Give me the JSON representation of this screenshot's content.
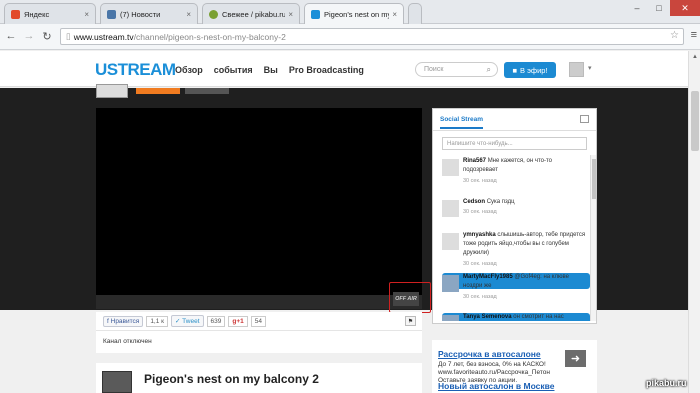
{
  "browser": {
    "tabs": [
      {
        "label": "Яндекс",
        "fav_color": "#e24b2b"
      },
      {
        "label": "(7) Новости",
        "fav_color": "#4a76a8"
      },
      {
        "label": "Свежее / pikabu.ru - Все",
        "fav_color": "#7aa032"
      },
      {
        "label": "Pigeon's nest on my balco",
        "fav_color": "#1b8fd8"
      }
    ],
    "url_host": "www.ustream.tv",
    "url_path": "/channel/pigeon-s-nest-on-my-balcony-2"
  },
  "header": {
    "logo": "USTREAM",
    "nav": [
      "Обзор",
      "события",
      "Вы",
      "Pro Broadcasting"
    ],
    "search_placeholder": "Поиск",
    "live_button": "В эфир!"
  },
  "player": {
    "status_badge": "OFF AIR"
  },
  "share": {
    "fb_label": "Нравится",
    "fb_count": "1,1 к",
    "tweet_label": "Tweet",
    "tweet_count": "639",
    "gplus_label": "+1",
    "gplus_count": "54"
  },
  "channel": {
    "status": "Канал отключен",
    "title": "Pigeon's nest on my balcony 2"
  },
  "social": {
    "tab": "Social Stream",
    "input_placeholder": "Напишите что-нибудь...",
    "posts": [
      {
        "user": "Rina567",
        "text": "Мне кажется, он что-то подозревает",
        "time": "30 сек. назад"
      },
      {
        "user": "Cedson",
        "text": "Сука пздц",
        "time": "30 сек. назад"
      },
      {
        "user": "ymnyashka",
        "text": "слышишь-автор, тебе придется тоже родить яйцо,чтобы вы с голубем дружили)",
        "time": "30 сек. назад"
      },
      {
        "user": "MartyMacFly1985",
        "text": "@Gof4eg: на клюве ноздри же",
        "time": "30 сек. назад"
      },
      {
        "user": "Tanya Semenova",
        "text": "он смотрит на нас",
        "time": ""
      }
    ]
  },
  "ad": {
    "headline1": "Рассрочка в автосалоне",
    "text": "До 7 лет, без взноса, 0% на КАСКО! www.favoriteauto.ru/Рассрочка_Петон Оставьте заявку по акции.",
    "headline2": "Новый автосалон в Москве"
  },
  "watermark": "pikabu.ru"
}
